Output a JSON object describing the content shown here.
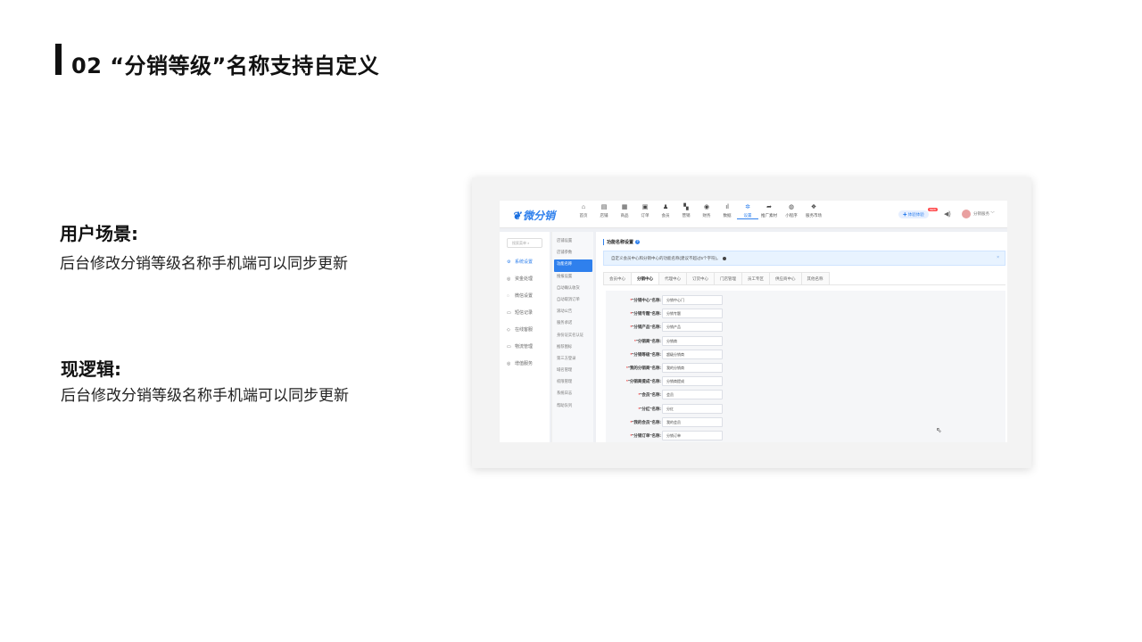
{
  "slide": {
    "title": "02 “分销等级”名称支持自定义",
    "scenario_heading": "用户场景:",
    "scenario_text": "后台修改分销等级名称手机端可以同步更新",
    "logic_heading": "现逻辑:",
    "logic_text": "后台修改分销等级名称手机端可以同步更新"
  },
  "app": {
    "logo": "微分销",
    "nav": [
      {
        "icon": "home-icon",
        "glyph": "⌂",
        "label": "首页"
      },
      {
        "icon": "store-icon",
        "glyph": "▤",
        "label": "店铺"
      },
      {
        "icon": "goods-icon",
        "glyph": "▦",
        "label": "商品"
      },
      {
        "icon": "order-icon",
        "glyph": "▣",
        "label": "订单"
      },
      {
        "icon": "member-icon",
        "glyph": "♟",
        "label": "会员"
      },
      {
        "icon": "marketing-icon",
        "glyph": "▚",
        "label": "营销"
      },
      {
        "icon": "finance-icon",
        "glyph": "◉",
        "label": "财务"
      },
      {
        "icon": "data-icon",
        "glyph": "ıl",
        "label": "数据"
      },
      {
        "icon": "settings-icon",
        "glyph": "✲",
        "label": "设置"
      },
      {
        "icon": "promo-icon",
        "glyph": "➦",
        "label": "推广素材"
      },
      {
        "icon": "miniapp-icon",
        "glyph": "◍",
        "label": "小程序"
      },
      {
        "icon": "market-icon",
        "glyph": "❖",
        "label": "服务市场"
      }
    ],
    "active_nav": "设置",
    "trial_label": "✚ 体验体验",
    "trial_badge": "NEW",
    "user_name": "分销服务 ﹀",
    "side_search": "搜索菜单 ⌕",
    "side1": [
      {
        "icon": "system-icon",
        "glyph": "⚙",
        "label": "系统设置",
        "active": true
      },
      {
        "icon": "fund-icon",
        "glyph": "◎",
        "label": "资金处理",
        "active": false
      },
      {
        "icon": "wechat-icon",
        "glyph": "◌",
        "label": "微信设置",
        "active": false
      },
      {
        "icon": "sms-icon",
        "glyph": "▭",
        "label": "短信记录",
        "active": false
      },
      {
        "icon": "online-icon",
        "glyph": "◇",
        "label": "在线客服",
        "active": false
      },
      {
        "icon": "logistics-icon",
        "glyph": "▭",
        "label": "物流管理",
        "active": false
      },
      {
        "icon": "value-added-icon",
        "glyph": "◎",
        "label": "增值服务",
        "active": false
      }
    ],
    "side2": [
      {
        "label": "店铺设置",
        "active": false
      },
      {
        "label": "店铺参数",
        "active": false
      },
      {
        "label": "功能名称",
        "active": true
      },
      {
        "label": "搜报设置",
        "active": false
      },
      {
        "label": "自动确认收货",
        "active": false
      },
      {
        "label": "自动取消订单",
        "active": false
      },
      {
        "label": "滚动公告",
        "active": false
      },
      {
        "label": "服务承诺",
        "active": false
      },
      {
        "label": "身份证实名认证",
        "active": false
      },
      {
        "label": "推荐图标",
        "active": false
      },
      {
        "label": "第三方登录",
        "active": false
      },
      {
        "label": "域名管理",
        "active": false
      },
      {
        "label": "权限管理",
        "active": false
      },
      {
        "label": "系统日志",
        "active": false
      },
      {
        "label": "帮助队列",
        "active": false
      }
    ],
    "panel_title": "功能名称设置",
    "notice": "自定义会员中心和分销中心的功能名称(建议不超过5个字符)。",
    "tabs": [
      {
        "label": "会员中心",
        "active": false
      },
      {
        "label": "分销中心",
        "active": true
      },
      {
        "label": "代理中心",
        "active": false
      },
      {
        "label": "订货中心",
        "active": false
      },
      {
        "label": "门店管理",
        "active": false
      },
      {
        "label": "员工专区",
        "active": false
      },
      {
        "label": "供应商中心",
        "active": false
      },
      {
        "label": "其他名称",
        "active": false
      }
    ],
    "form": [
      {
        "label": "\"分销中心\"名称:",
        "value": "分销中心门"
      },
      {
        "label": "\"分销专题\"名称:",
        "value": "分销专题"
      },
      {
        "label": "\"分销产品\"名称:",
        "value": "分销产品"
      },
      {
        "label": "\"分销商\"名称:",
        "value": "分销商"
      },
      {
        "label": "\"分销等级\"名称:",
        "value": "超级分销商"
      },
      {
        "label": "\"我的分销商\"名称:",
        "value": "我的分销商"
      },
      {
        "label": "\"分销商提成\"名称:",
        "value": "分销商提成"
      },
      {
        "label": "\"会员\"名称:",
        "value": "会员"
      },
      {
        "label": "\"分红\"名称:",
        "value": "分红"
      },
      {
        "label": "\"我的会员\"名称:",
        "value": "我的会员"
      },
      {
        "label": "\"分销订单\"名称:",
        "value": "分销订单"
      }
    ],
    "colors": {
      "accent": "#2f80ed",
      "notice_bg": "#e8f3ff",
      "required": "#ee3333"
    }
  }
}
